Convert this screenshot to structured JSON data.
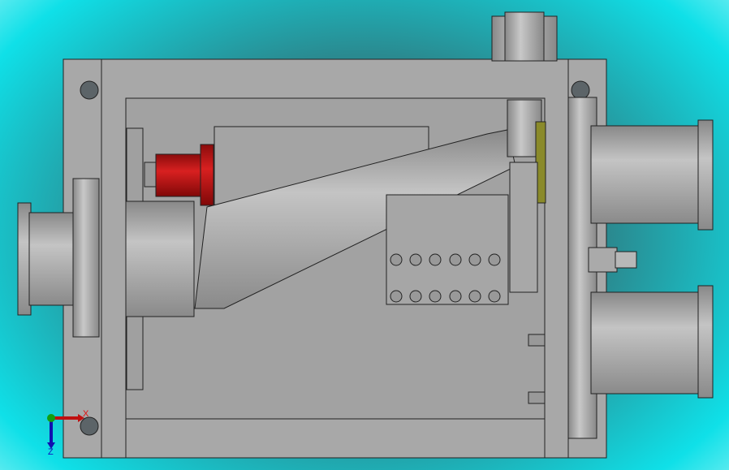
{
  "viewport": {
    "background_colors": {
      "center": "#3a6e72",
      "edge": "#0fe0e8"
    },
    "part_color": "#a7a7a7",
    "accent_part_color": "#c01818",
    "highlight_part_color": "#8a8a2a"
  },
  "triad": {
    "x_label": "X",
    "z_label": "Z",
    "x_color": "#c01010",
    "y_color": "#10a010",
    "z_color": "#1010b0"
  }
}
